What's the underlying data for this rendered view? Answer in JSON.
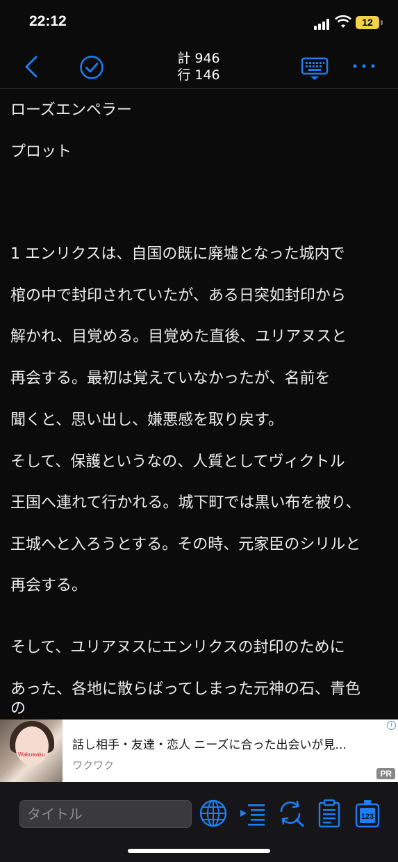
{
  "status_bar": {
    "time": "22:12",
    "battery": "12"
  },
  "nav": {
    "total_count": "計 946",
    "line_count": "行 146"
  },
  "document": {
    "lines": [
      "ローズエンペラー",
      "プロット",
      "",
      "1 エンリクスは、自国の既に廃墟となった城内で",
      "棺の中で封印されていたが、ある日突如封印から",
      "解かれ、目覚める。目覚めた直後、ユリアヌスと",
      "再会する。最初は覚えていなかったが、名前を",
      "聞くと、思い出し、嫌悪感を取り戻す。",
      "そして、保護というなの、人質としてヴィクトル",
      "王国へ連れて行かれる。城下町では黒い布を被り、",
      "王城へと入ろうとする。その時、元家臣のシリルと",
      "再会する。",
      "",
      "そして、ユリアヌスにエンリクスの封印のために",
      "あった、各地に散らばってしまった元神の石、青色",
      "の"
    ]
  },
  "ad": {
    "title": "話し相手・友達・恋人 ニーズに合った出会いが見...",
    "source": "ワクワク",
    "image_caption": "Wakuwaku",
    "pr_label": "PR",
    "info": "i"
  },
  "toolbar": {
    "title_placeholder": "タイトル"
  },
  "colors": {
    "accent": "#1f7ef2",
    "background": "#0b0b0c"
  }
}
